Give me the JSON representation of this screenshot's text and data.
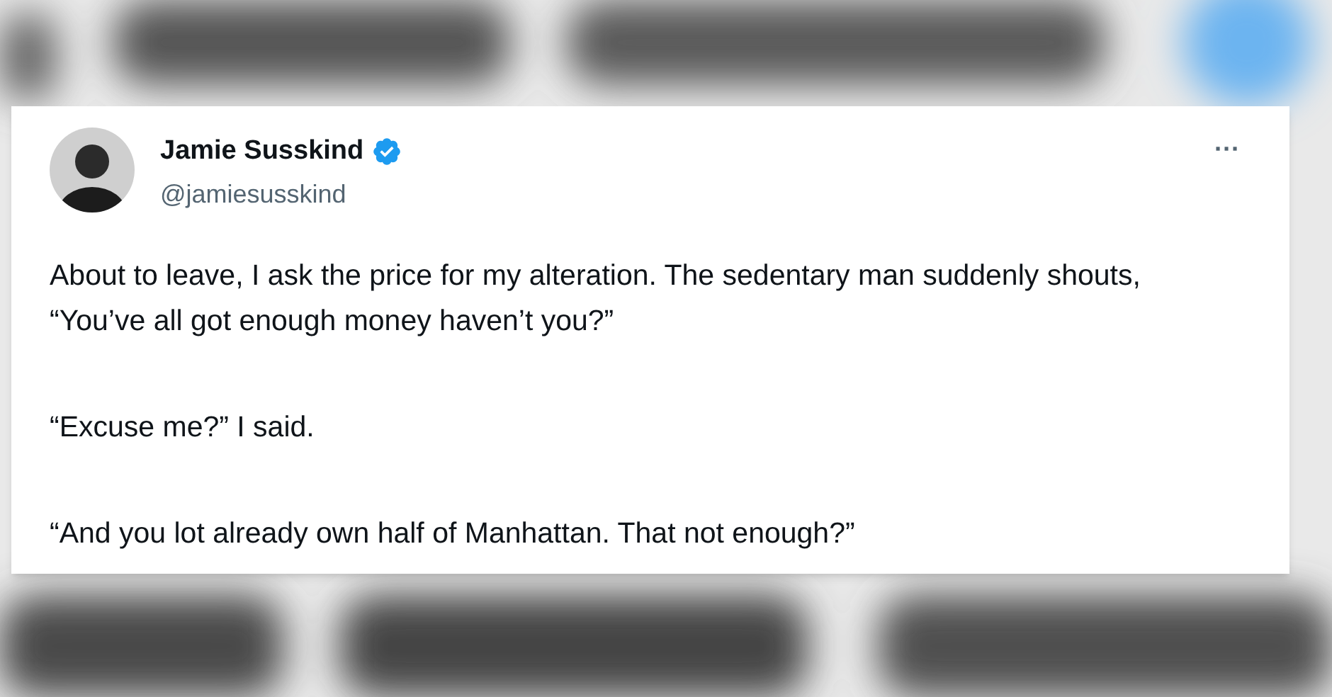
{
  "tweet": {
    "author": {
      "name": "Jamie Susskind",
      "verified": true,
      "handle": "@jamiesusskind"
    },
    "more": "···",
    "paragraphs": [
      "About to leave, I ask the price for my alteration. The sedentary man suddenly shouts, “You’ve all got enough money haven’t you?”",
      "“Excuse me?” I said.",
      "“And you lot already own half of Manhattan. That not enough?”"
    ]
  }
}
